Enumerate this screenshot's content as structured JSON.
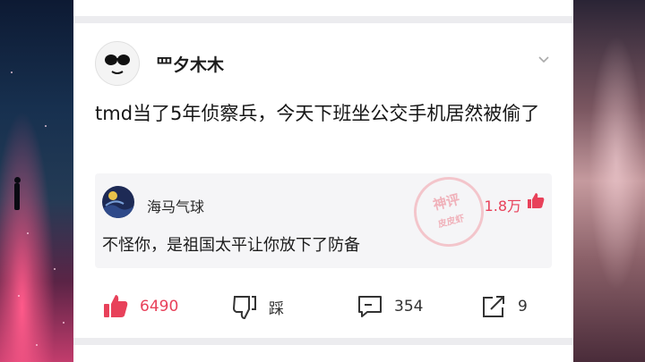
{
  "post": {
    "username": "罒夕木木",
    "text": "tmd当了5年侦察兵，今天下班坐公交手机居然被偷了"
  },
  "top_reply": {
    "author": "海马气球",
    "likes": "1.8万",
    "text": "不怪你，是祖国太平让你放下了防备",
    "stamp_line1": "神评",
    "stamp_line2": "皮皮虾"
  },
  "actions": {
    "like_count": "6490",
    "dislike_label": "踩",
    "comment_count": "354",
    "share_count": "9"
  },
  "colors": {
    "accent": "#e8415a",
    "card_bg": "#ffffff",
    "reply_bg": "#f5f5f7"
  },
  "icons": [
    "more-chevron-icon",
    "thumb-up-icon",
    "thumb-down-icon",
    "comment-icon",
    "share-icon"
  ]
}
